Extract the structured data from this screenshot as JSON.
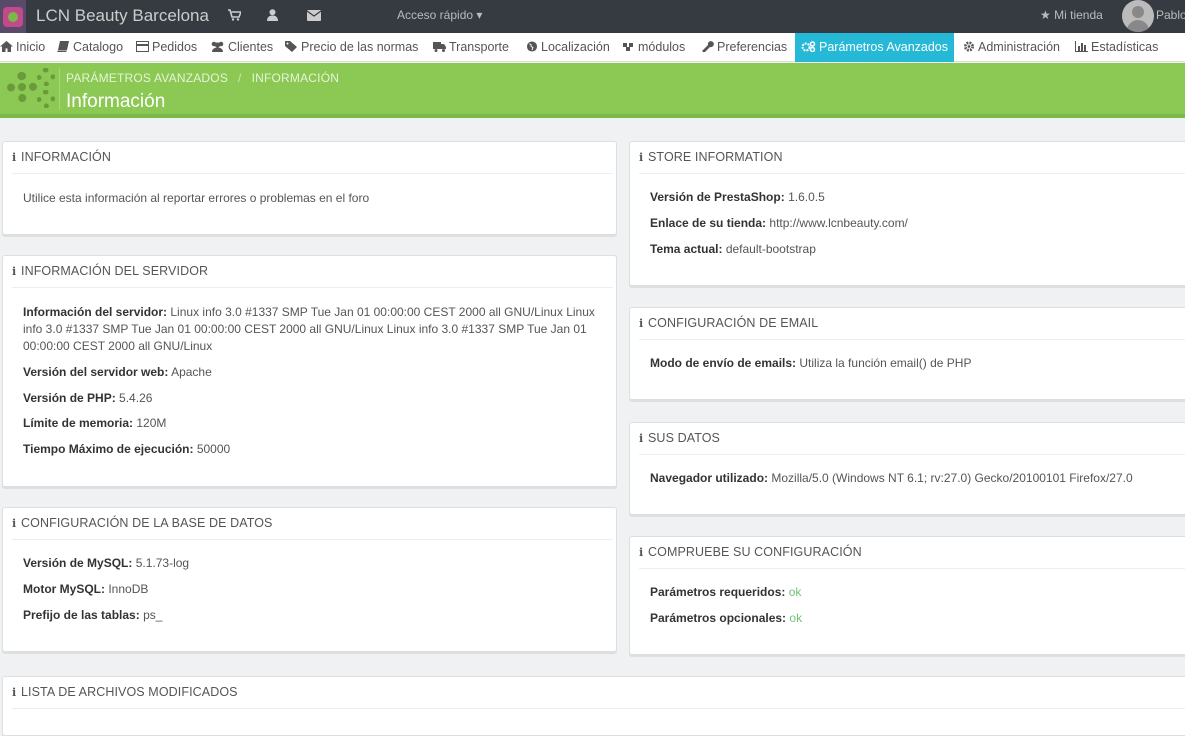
{
  "topbar": {
    "shop_name": "LCN Beauty Barcelona",
    "quick_access": "Acceso rápido",
    "my_shop": "Mi tienda",
    "username": "Pablo"
  },
  "nav": {
    "items": [
      {
        "label": "Inicio",
        "icon": "home-icon"
      },
      {
        "label": "Catalogo",
        "icon": "book-icon"
      },
      {
        "label": "Pedidos",
        "icon": "credit-card-icon"
      },
      {
        "label": "Clientes",
        "icon": "users-icon"
      },
      {
        "label": "Precio de las normas",
        "icon": "tags-icon"
      },
      {
        "label": "Transporte",
        "icon": "truck-icon"
      },
      {
        "label": "Localización",
        "icon": "globe-icon"
      },
      {
        "label": "módulos",
        "icon": "puzzle-icon"
      },
      {
        "label": "Preferencias",
        "icon": "wrench-icon"
      },
      {
        "label": "Parámetros Avanzados",
        "icon": "cogs-icon",
        "active": true
      },
      {
        "label": "Administración",
        "icon": "cog-icon"
      },
      {
        "label": "Estadísticas",
        "icon": "bar-chart-icon"
      }
    ]
  },
  "header": {
    "breadcrumb": [
      "PARÁMETROS AVANZADOS",
      "INFORMACIÓN"
    ],
    "title": "Información",
    "accent_color": "#8bc954"
  },
  "panels": {
    "info": {
      "title": "INFORMACIÓN",
      "text": "Utilice esta información al reportar errores o problemas en el foro"
    },
    "server": {
      "title": "INFORMACIÓN DEL SERVIDOR",
      "rows": [
        {
          "label": "Información del servidor:",
          "value": "Linux info 3.0 #1337 SMP Tue Jan 01 00:00:00 CEST 2000 all GNU/Linux Linux info 3.0 #1337 SMP Tue Jan 01 00:00:00 CEST 2000 all GNU/Linux Linux info 3.0 #1337 SMP Tue Jan 01 00:00:00 CEST 2000 all GNU/Linux"
        },
        {
          "label": "Versión del servidor web:",
          "value": "Apache"
        },
        {
          "label": "Versión de PHP:",
          "value": "5.4.26"
        },
        {
          "label": "Límite de memoria:",
          "value": "120M"
        },
        {
          "label": "Tiempo Máximo de ejecución:",
          "value": "50000"
        }
      ]
    },
    "database": {
      "title": "CONFIGURACIÓN DE LA BASE DE DATOS",
      "rows": [
        {
          "label": "Versión de MySQL:",
          "value": "5.1.73-log"
        },
        {
          "label": "Motor MySQL:",
          "value": "InnoDB"
        },
        {
          "label": "Prefijo de las tablas:",
          "value": "ps_"
        }
      ]
    },
    "modified_files": {
      "title": "LISTA DE ARCHIVOS MODIFICADOS"
    },
    "store": {
      "title": "STORE INFORMATION",
      "rows": [
        {
          "label": "Versión de PrestaShop:",
          "value": "1.6.0.5"
        },
        {
          "label": "Enlace de su tienda:",
          "value": "http://www.lcnbeauty.com/"
        },
        {
          "label": "Tema actual:",
          "value": "default-bootstrap"
        }
      ]
    },
    "email": {
      "title": "CONFIGURACIÓN DE EMAIL",
      "rows": [
        {
          "label": "Modo de envío de emails:",
          "value": "Utiliza la función email() de PHP"
        }
      ]
    },
    "your_data": {
      "title": "SUS DATOS",
      "rows": [
        {
          "label": "Navegador utilizado:",
          "value": "Mozilla/5.0 (Windows NT 6.1; rv:27.0) Gecko/20100101 Firefox/27.0"
        }
      ]
    },
    "check": {
      "title": "COMPRUEBE SU CONFIGURACIÓN",
      "rows": [
        {
          "label": "Parámetros requeridos:",
          "value": "ok"
        },
        {
          "label": "Parámetros opcionales:",
          "value": "ok"
        }
      ],
      "ok_color": "#72c279"
    }
  }
}
